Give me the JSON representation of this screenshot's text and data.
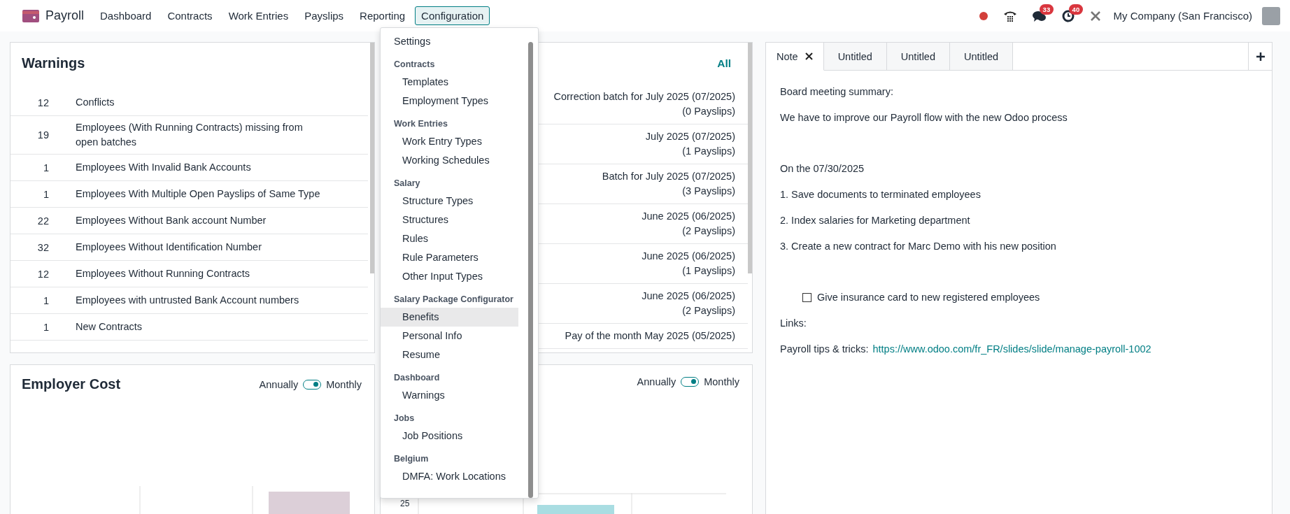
{
  "navbar": {
    "app_name": "Payroll",
    "menus": [
      {
        "label": "Dashboard",
        "selected": false
      },
      {
        "label": "Contracts",
        "selected": false
      },
      {
        "label": "Work Entries",
        "selected": false
      },
      {
        "label": "Payslips",
        "selected": false
      },
      {
        "label": "Reporting",
        "selected": false
      },
      {
        "label": "Configuration",
        "selected": true
      }
    ],
    "messages_badge": "33",
    "activities_badge": "40",
    "company": "My Company (San Francisco)"
  },
  "configuration_menu": [
    {
      "items": [
        {
          "label": "Settings",
          "selected": false
        }
      ]
    },
    {
      "title": "Contracts",
      "items": [
        {
          "label": "Templates",
          "selected": false
        },
        {
          "label": "Employment Types",
          "selected": false
        }
      ]
    },
    {
      "title": "Work Entries",
      "items": [
        {
          "label": "Work Entry Types",
          "selected": false
        },
        {
          "label": "Working Schedules",
          "selected": false
        }
      ]
    },
    {
      "title": "Salary",
      "items": [
        {
          "label": "Structure Types",
          "selected": false
        },
        {
          "label": "Structures",
          "selected": false
        },
        {
          "label": "Rules",
          "selected": false
        },
        {
          "label": "Rule Parameters",
          "selected": false
        },
        {
          "label": "Other Input Types",
          "selected": false
        }
      ]
    },
    {
      "title": "Salary Package Configurator",
      "items": [
        {
          "label": "Benefits",
          "selected": true
        },
        {
          "label": "Personal Info",
          "selected": false
        },
        {
          "label": "Resume",
          "selected": false
        }
      ]
    },
    {
      "title": "Dashboard",
      "items": [
        {
          "label": "Warnings",
          "selected": false
        }
      ]
    },
    {
      "title": "Jobs",
      "items": [
        {
          "label": "Job Positions",
          "selected": false
        }
      ]
    },
    {
      "title": "Belgium",
      "items": [
        {
          "label": "DMFA: Work Locations",
          "selected": false
        }
      ]
    }
  ],
  "warnings": {
    "title": "Warnings",
    "rows": [
      {
        "count": "12",
        "label": "Conflicts"
      },
      {
        "count": "19",
        "label": "Employees (With Running Contracts) missing from open batches"
      },
      {
        "count": "1",
        "label": "Employees With Invalid Bank Accounts"
      },
      {
        "count": "1",
        "label": "Employees With Multiple Open Payslips of Same Type"
      },
      {
        "count": "22",
        "label": "Employees Without Bank account Number"
      },
      {
        "count": "32",
        "label": "Employees Without Identification Number"
      },
      {
        "count": "12",
        "label": "Employees Without Running Contracts"
      },
      {
        "count": "1",
        "label": "Employees with untrusted Bank Account numbers"
      },
      {
        "count": "1",
        "label": "New Contracts"
      }
    ]
  },
  "batches": {
    "link": "All",
    "rows": [
      {
        "name": "Correction batch for July 2025 (07/2025)",
        "count": "(0 Payslips)"
      },
      {
        "name": "July 2025 (07/2025)",
        "count": "(1 Payslips)"
      },
      {
        "name": "Batch for July 2025 (07/2025)",
        "count": "(3 Payslips)"
      },
      {
        "name": "June 2025 (06/2025)",
        "count": "(2 Payslips)"
      },
      {
        "name": "June 2025 (06/2025)",
        "count": "(1 Payslips)"
      },
      {
        "name": "June 2025 (06/2025)",
        "count": "(2 Payslips)"
      },
      {
        "name": "Pay of the month May 2025 (05/2025)"
      }
    ]
  },
  "charts": [
    {
      "title": "Employer Cost",
      "toggle": {
        "left": "Annually",
        "right": "Monthly",
        "on": true
      }
    },
    {
      "toggle": {
        "left": "Annually",
        "right": "Monthly",
        "on": true
      },
      "axis_label": "25"
    }
  ],
  "note": {
    "tabs": [
      {
        "label": "Note",
        "selected": true
      },
      {
        "label": "Untitled",
        "selected": false
      },
      {
        "label": "Untitled",
        "selected": false
      },
      {
        "label": "Untitled",
        "selected": false
      }
    ],
    "lines": [
      {
        "kind": "text",
        "text": "Board meeting summary:"
      },
      {
        "kind": "text",
        "text": "We have to improve our Payroll flow with the new Odoo process"
      },
      {
        "kind": "blank"
      },
      {
        "kind": "text",
        "text": "On the 07/30/2025"
      },
      {
        "kind": "text",
        "text": "1. Save documents to terminated employees"
      },
      {
        "kind": "text",
        "text": "2. Index salaries for Marketing department"
      },
      {
        "kind": "text",
        "text": "3. Create a new contract for Marc Demo with his new position"
      },
      {
        "kind": "blank"
      },
      {
        "kind": "task",
        "text": "Give insurance card to new registered employees",
        "checked": false
      },
      {
        "kind": "text",
        "text": "Links:"
      },
      {
        "kind": "link",
        "text": "Payroll tips & tricks:",
        "url": "https://www.odoo.com/fr_FR/slides/slide/manage-payroll-1002"
      }
    ]
  }
}
